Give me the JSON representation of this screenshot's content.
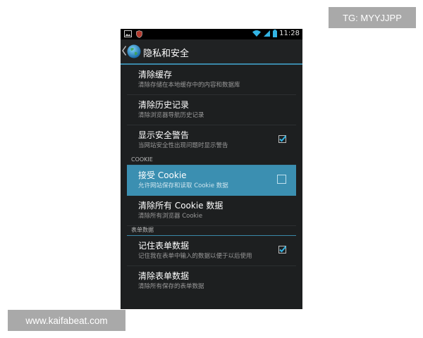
{
  "status_bar": {
    "time": "11:28",
    "left_icons": [
      "image-notification-icon",
      "shield-notification-icon"
    ],
    "right_icons": [
      "wifi-icon",
      "signal-icon",
      "battery-icon"
    ]
  },
  "action_bar": {
    "title": "隐私和安全"
  },
  "settings": {
    "clear_cache": {
      "title": "清除缓存",
      "summary": "清除存储在本地缓存中的内容和数据库"
    },
    "clear_history": {
      "title": "清除历史记录",
      "summary": "清除浏览器导航历史记录"
    },
    "security_warnings": {
      "title": "显示安全警告",
      "summary": "当网站安全性出现问题时显示警告",
      "checked": true
    },
    "cookie_section": "COOKIE",
    "accept_cookies": {
      "title": "接受 Cookie",
      "summary": "允许网站保存和读取 Cookie 数据",
      "checked": false
    },
    "clear_cookies": {
      "title": "清除所有 Cookie 数据",
      "summary": "清除所有浏览器 Cookie"
    },
    "form_section": "表单数据",
    "remember_form": {
      "title": "记住表单数据",
      "summary": "记住我在表单中输入的数据以便于以后使用",
      "checked": true
    },
    "clear_form": {
      "title": "清除表单数据",
      "summary": "清除所有保存的表单数据"
    }
  },
  "colors": {
    "accent": "#3b8fb1",
    "background": "#1d1f20",
    "status_bar": "#000000"
  },
  "watermarks": {
    "top_right": "TG: MYYJJPP",
    "bottom_left": "www.kaifabeat.com"
  }
}
